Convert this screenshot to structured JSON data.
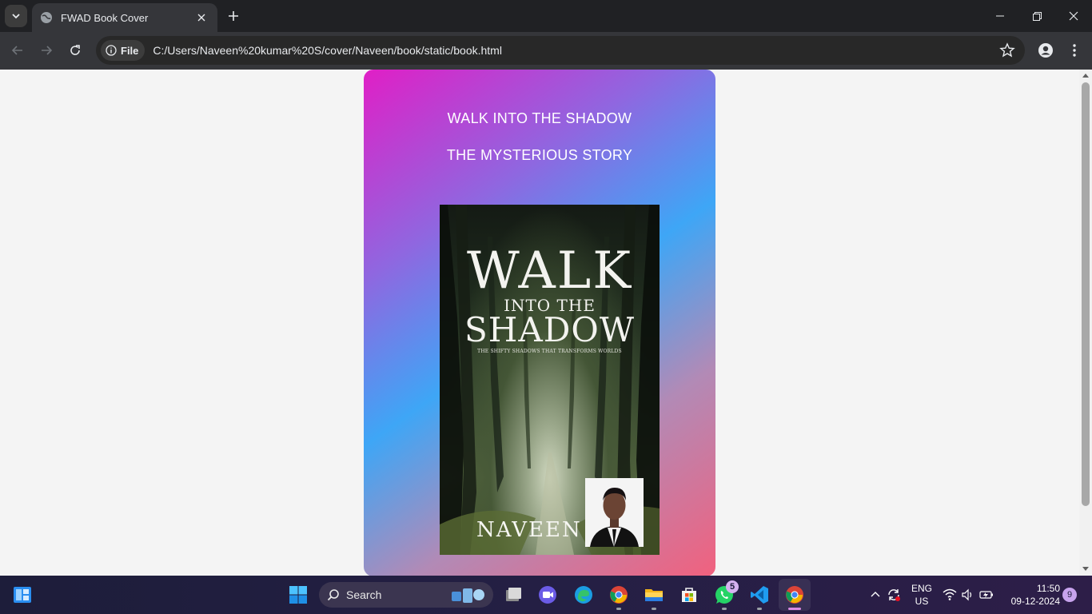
{
  "browser": {
    "tab_title": "FWAD Book Cover",
    "url_chip": "File",
    "url": "C:/Users/Naveen%20kumar%20S/cover/Naveen/book/static/book.html"
  },
  "page": {
    "title_line_1": "WALK INTO THE SHADOW",
    "title_line_2": "THE MYSTERIOUS STORY",
    "gradient_colors": [
      "#e01fc6",
      "#3ea6f6",
      "#f1617e"
    ]
  },
  "cover": {
    "title_word_1": "WALK",
    "title_word_2": "INTO THE",
    "title_word_3": "SHADOW",
    "tagline": "THE SHIFTY SHADOWS THAT TRANSFORMS WORLDS",
    "author": "NAVEEN"
  },
  "taskbar": {
    "search_label": "Search",
    "whatsapp_badge": "5",
    "language": "ENG",
    "region": "US",
    "time": "11:50",
    "date": "09-12-2024",
    "notification_count": "9"
  }
}
